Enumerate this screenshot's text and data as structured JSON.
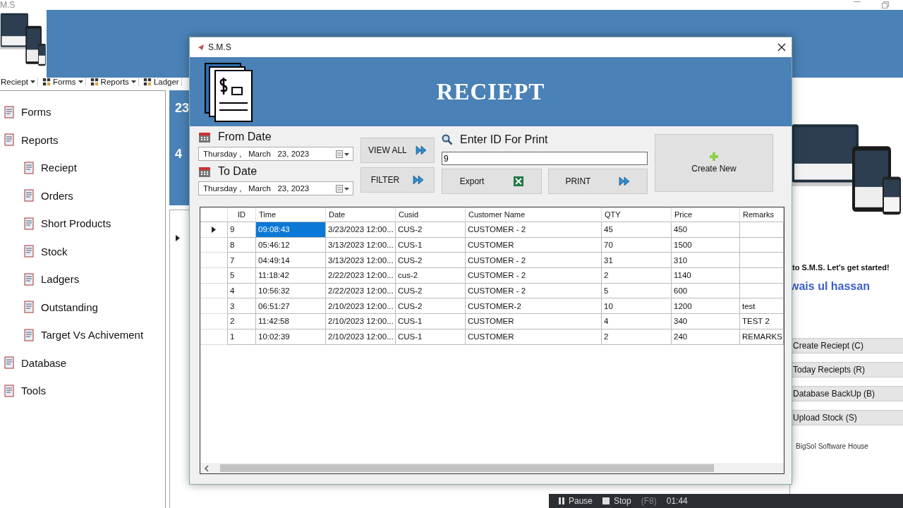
{
  "main_window": {
    "title": "M.S",
    "toolbar": [
      {
        "label": "Reciept",
        "dropdown": true
      },
      {
        "label": "Forms",
        "dropdown": true
      },
      {
        "label": "Reports",
        "dropdown": true
      },
      {
        "label": "Ladger",
        "dropdown": false
      }
    ],
    "tree": [
      {
        "label": "Forms"
      },
      {
        "label": "Reports",
        "children": [
          {
            "label": "Reciept"
          },
          {
            "label": "Orders"
          },
          {
            "label": "Short Products"
          },
          {
            "label": "Stock"
          },
          {
            "label": "Ladgers"
          },
          {
            "label": "Outstanding"
          },
          {
            "label": "Target Vs Achivement"
          }
        ]
      },
      {
        "label": "Database"
      },
      {
        "label": "Tools"
      }
    ],
    "dashboard": {
      "value_1": "23",
      "value_2": "4"
    },
    "welcome": "to S.M.S. Let's get started!",
    "user_name": "wais ul hassan",
    "actions": [
      "Create Reciept (C)",
      "Today Reciepts (R)",
      "Database BackUp (B)",
      "Upload Stock (S)"
    ],
    "footer": "BigSol Software House"
  },
  "dialog": {
    "title": "S.M.S",
    "heading": "RECIEPT",
    "from_label": "From Date",
    "from_date": "Thursday ,   March   23, 2023",
    "to_label": "To Date",
    "to_date": "Thursday ,   March   23, 2023",
    "view_all": "VIEW ALL",
    "filter": "FILTER",
    "search_label": "Enter ID For Print",
    "search_value": "9",
    "export": "Export",
    "print": "PRINT",
    "create": "Create New",
    "columns": [
      "ID",
      "Time",
      "Date",
      "Cusid",
      "Customer Name",
      "QTY",
      "Price",
      "Remarks"
    ],
    "rows": [
      {
        "selected": true,
        "cells": [
          "9",
          "09:08:43",
          "3/23/2023 12:00...",
          "CUS-2",
          "CUSTOMER - 2",
          "45",
          "450",
          ""
        ]
      },
      {
        "selected": false,
        "cells": [
          "8",
          "05:46:12",
          "3/13/2023 12:00...",
          "CUS-1",
          "CUSTOMER",
          "70",
          "1500",
          ""
        ]
      },
      {
        "selected": false,
        "cells": [
          "7",
          "04:49:14",
          "3/13/2023 12:00...",
          "CUS-2",
          "CUSTOMER - 2",
          "31",
          "310",
          ""
        ]
      },
      {
        "selected": false,
        "cells": [
          "5",
          "11:18:42",
          "2/22/2023 12:00...",
          "cus-2",
          "CUSTOMER - 2",
          "2",
          "1140",
          ""
        ]
      },
      {
        "selected": false,
        "cells": [
          "4",
          "10:56:32",
          "2/22/2023 12:00...",
          "CUS-2",
          "CUSTOMER - 2",
          "5",
          "600",
          ""
        ]
      },
      {
        "selected": false,
        "cells": [
          "3",
          "06:51:27",
          "2/10/2023 12:00...",
          "CUS-2",
          "CUSTOMER-2",
          "10",
          "1200",
          "test"
        ]
      },
      {
        "selected": false,
        "cells": [
          "2",
          "11:42:58",
          "2/10/2023 12:00...",
          "CUS-1",
          "CUSTOMER",
          "4",
          "340",
          "TEST 2"
        ]
      },
      {
        "selected": false,
        "cells": [
          "1",
          "10:02:39",
          "2/10/2023 12:00...",
          "CUS-1",
          "CUSTOMER",
          "2",
          "240",
          "REMARKS"
        ]
      }
    ]
  },
  "recorder_bar": {
    "pause": "Pause",
    "stop": "Stop",
    "stop_key": "(F8)",
    "time": "01:44"
  }
}
